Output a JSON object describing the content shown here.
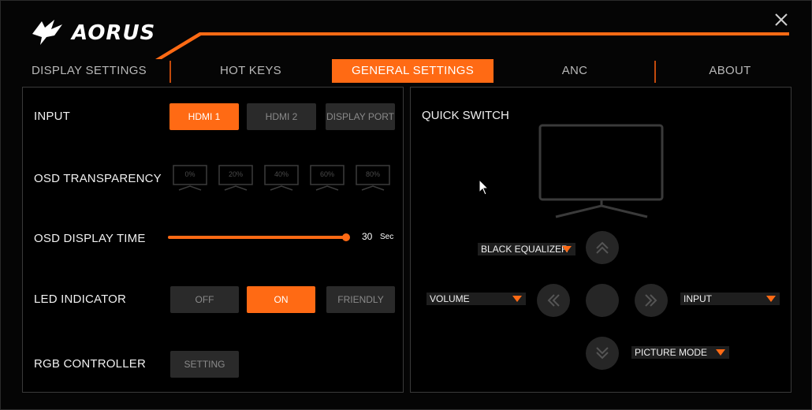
{
  "app": {
    "logo_text": "AORUS"
  },
  "tabs": [
    {
      "label": "DISPLAY SETTINGS",
      "active": false
    },
    {
      "label": "HOT KEYS",
      "active": false
    },
    {
      "label": "GENERAL SETTINGS",
      "active": true
    },
    {
      "label": "ANC",
      "active": false
    },
    {
      "label": "ABOUT",
      "active": false
    }
  ],
  "general": {
    "input": {
      "label": "INPUT",
      "options": [
        "HDMI 1",
        "HDMI 2",
        "DISPLAY PORT"
      ],
      "selected": "HDMI 1"
    },
    "osd_transparency": {
      "label": "OSD TRANSPARENCY",
      "options": [
        "0%",
        "20%",
        "40%",
        "60%",
        "80%"
      ]
    },
    "osd_display_time": {
      "label": "OSD DISPLAY TIME",
      "value": "30",
      "unit": "Sec"
    },
    "led_indicator": {
      "label": "LED INDICATOR",
      "options": [
        "OFF",
        "ON",
        "FRIENDLY"
      ],
      "selected": "ON"
    },
    "rgb_controller": {
      "label": "RGB CONTROLLER",
      "button": "SETTING"
    }
  },
  "quick_switch": {
    "title": "QUICK SWITCH",
    "up": "BLACK EQUALIZER",
    "left": "VOLUME",
    "right": "INPUT",
    "down": "PICTURE MODE"
  },
  "colors": {
    "accent": "#ff6a14",
    "button_bg": "#2a2a2a",
    "panel_border": "#3a3a3a"
  }
}
